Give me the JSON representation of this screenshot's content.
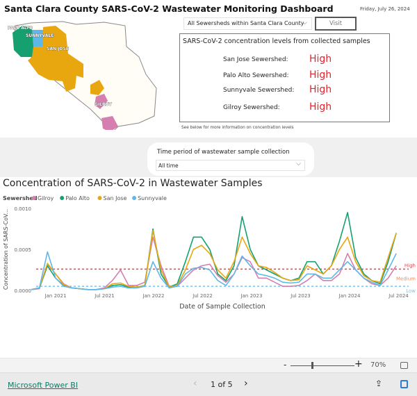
{
  "header": {
    "title": "Santa Clara County SARS-CoV-2 Wastewater Monitoring Dashboard",
    "date": "Friday, July 26, 2024"
  },
  "map": {
    "labels": [
      "PALO ALTO",
      "SUNNYVALE",
      "SAN JOSE",
      "GILROY"
    ],
    "colors": {
      "palo_alto": "#16a06f",
      "sunnyvale": "#5fb7e8",
      "san_jose": "#e8a70f",
      "gilroy": "#d47fb0",
      "county": "#fffdf5"
    }
  },
  "sewershed_select": {
    "value": "All Sewersheds within Santa Clara County",
    "visit_label": "Visit"
  },
  "levels": {
    "heading": "SARS-CoV-2 concentration levels from collected samples",
    "rows": [
      {
        "name": "San Jose Sewershed:",
        "level": "High"
      },
      {
        "name": "Palo Alto Sewershed:",
        "level": "High"
      },
      {
        "name": "Sunnyvale Sewershed:",
        "level": "High"
      },
      {
        "name": "Gilroy Sewershed:",
        "level": "High"
      }
    ],
    "note": "See below for more information on concentration levels",
    "level_color": "#e8202a"
  },
  "filter": {
    "label": "Time period of wastewater sample collection",
    "value": "All time"
  },
  "chart_title": "Concentration of SARS-CoV-2 in Wastewater Samples",
  "chart_data": {
    "type": "line",
    "title": "Concentration of SARS-CoV-2 in Wastewater Samples",
    "xlabel": "Date of Sample Collection",
    "ylabel": "Concentration of SARS-CoV...",
    "legend_title": "Sewershed",
    "legend_placement": "top-left",
    "ylim": [
      0,
      0.001
    ],
    "yticks": [
      "0.0000",
      "0.0005",
      "0.0010"
    ],
    "xticks": [
      "Jan 2021",
      "Jul 2021",
      "Jan 2022",
      "Jul 2022",
      "Jan 2023",
      "Jul 2023",
      "Jan 2024",
      "Jul 2024"
    ],
    "x": [
      "2020-10",
      "2020-11",
      "2020-12",
      "2021-01",
      "2021-02",
      "2021-03",
      "2021-04",
      "2021-05",
      "2021-06",
      "2021-07",
      "2021-08",
      "2021-09",
      "2021-10",
      "2021-11",
      "2021-12",
      "2022-01",
      "2022-02",
      "2022-03",
      "2022-04",
      "2022-05",
      "2022-06",
      "2022-07",
      "2022-08",
      "2022-09",
      "2022-10",
      "2022-11",
      "2022-12",
      "2023-01",
      "2023-02",
      "2023-03",
      "2023-04",
      "2023-05",
      "2023-06",
      "2023-07",
      "2023-08",
      "2023-09",
      "2023-10",
      "2023-11",
      "2023-12",
      "2024-01",
      "2024-02",
      "2024-03",
      "2024-04",
      "2024-05",
      "2024-06",
      "2024-07"
    ],
    "series": [
      {
        "name": "Gilroy",
        "color": "#d47fb0",
        "values": [
          1e-05,
          2e-05,
          0.00032,
          0.0002,
          8e-05,
          3e-05,
          2e-05,
          1e-05,
          1e-05,
          3e-05,
          0.00012,
          0.00025,
          6e-05,
          6e-05,
          0.0001,
          0.00065,
          0.0003,
          5e-05,
          5e-05,
          0.00015,
          0.00025,
          0.0003,
          0.00032,
          0.00018,
          0.0001,
          0.0002,
          0.0004,
          0.00035,
          0.00015,
          0.00015,
          0.0001,
          5e-05,
          5e-05,
          6e-05,
          0.00012,
          0.0002,
          0.00012,
          0.00012,
          0.0002,
          0.00045,
          0.00025,
          0.00015,
          8e-05,
          6e-05,
          0.00015,
          0.0003
        ]
      },
      {
        "name": "Palo Alto",
        "color": "#16a06f",
        "values": [
          1e-05,
          3e-05,
          0.0003,
          0.00015,
          6e-05,
          3e-05,
          2e-05,
          1e-05,
          1e-05,
          2e-05,
          6e-05,
          7e-05,
          4e-05,
          4e-05,
          6e-05,
          0.00075,
          0.0002,
          4e-05,
          8e-05,
          0.00035,
          0.00065,
          0.00065,
          0.0005,
          0.0002,
          0.00012,
          0.0003,
          0.0009,
          0.0005,
          0.0003,
          0.00025,
          0.0002,
          0.00015,
          0.00012,
          0.00015,
          0.00035,
          0.00035,
          0.0002,
          0.0003,
          0.0006,
          0.00095,
          0.0004,
          0.0002,
          0.00012,
          8e-05,
          0.00035,
          0.0007
        ]
      },
      {
        "name": "San Jose",
        "color": "#e8a70f",
        "values": [
          1e-05,
          3e-05,
          0.00033,
          0.0002,
          7e-05,
          3e-05,
          2e-05,
          1e-05,
          1e-05,
          2e-05,
          8e-05,
          9e-05,
          5e-05,
          4e-05,
          6e-05,
          0.00073,
          0.00025,
          4e-05,
          6e-05,
          0.00025,
          0.0005,
          0.00055,
          0.00045,
          0.00025,
          0.00015,
          0.00035,
          0.00065,
          0.00045,
          0.0003,
          0.00028,
          0.00022,
          0.00015,
          0.00012,
          0.00013,
          0.0003,
          0.00025,
          0.0002,
          0.0003,
          0.0005,
          0.00065,
          0.00035,
          0.00018,
          0.00012,
          0.0001,
          0.0004,
          0.0007
        ]
      },
      {
        "name": "Sunnyvale",
        "color": "#5fb7e8",
        "values": [
          1e-05,
          3e-05,
          0.00047,
          0.00015,
          5e-05,
          3e-05,
          2e-05,
          1e-05,
          1e-05,
          2e-05,
          4e-05,
          5e-05,
          3e-05,
          3e-05,
          5e-05,
          0.00035,
          0.00015,
          3e-05,
          5e-05,
          0.0002,
          0.00027,
          0.00028,
          0.00025,
          0.00012,
          6e-05,
          0.0002,
          0.00042,
          0.0003,
          0.0002,
          0.00018,
          0.00015,
          0.0001,
          9e-05,
          0.0001,
          0.0002,
          0.0002,
          0.00015,
          0.00015,
          0.00025,
          0.00035,
          0.00025,
          0.00015,
          0.0001,
          6e-05,
          0.00025,
          0.00045
        ]
      }
    ],
    "thresholds": [
      {
        "label": "High",
        "value": 0.00026,
        "color": "#e0474c"
      },
      {
        "label": "Medium",
        "value": 0.00015,
        "color": "#f08a5d"
      },
      {
        "label": "Low",
        "value": 5e-05,
        "color": "#7cc0ef"
      }
    ]
  },
  "toolbar": {
    "zoom_minus": "-",
    "zoom_plus": "+",
    "zoom_level": "70%",
    "zoom_fraction": 0.35
  },
  "footer": {
    "brand": "Microsoft Power BI",
    "page": "1 of 5",
    "prev": "‹",
    "next": "›"
  }
}
